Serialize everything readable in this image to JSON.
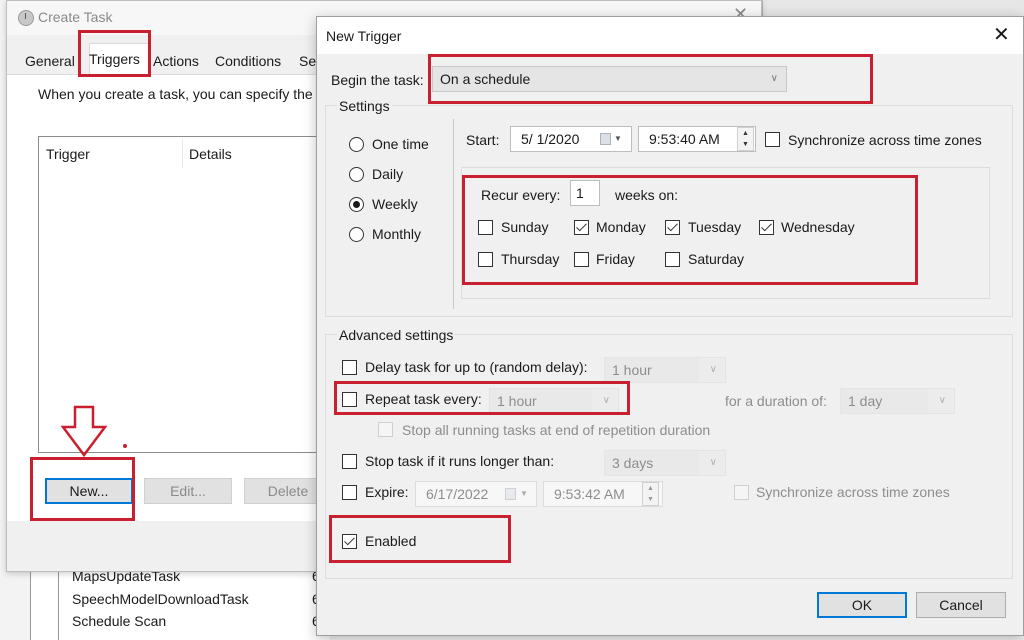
{
  "background": {
    "task_rows": [
      {
        "name": "MapsUpdateTask",
        "extra": "6"
      },
      {
        "name": "SpeechModelDownloadTask",
        "extra": "6"
      },
      {
        "name": "Schedule Scan",
        "extra": "6"
      }
    ]
  },
  "create_task": {
    "title": "Create Task",
    "tabs": [
      "General",
      "Triggers",
      "Actions",
      "Conditions",
      "Set"
    ],
    "active_tab": "Triggers",
    "description": "When you create a task, you can specify the",
    "columns": [
      "Trigger",
      "Details"
    ],
    "buttons": {
      "new": "New...",
      "edit": "Edit...",
      "delete": "Delete"
    }
  },
  "new_trigger": {
    "title": "New Trigger",
    "begin_label": "Begin the task:",
    "begin_value": "On a schedule",
    "settings_label": "Settings",
    "schedule_options": [
      {
        "label": "One time",
        "checked": false
      },
      {
        "label": "Daily",
        "checked": false
      },
      {
        "label": "Weekly",
        "checked": true
      },
      {
        "label": "Monthly",
        "checked": false
      }
    ],
    "start_label": "Start:",
    "start_date": "5/ 1/2020",
    "start_time": "9:53:40 AM",
    "sync_label": "Synchronize across time zones",
    "sync_checked": false,
    "recur_label": "Recur every:",
    "recur_value": "1",
    "recur_unit": "weeks on:",
    "days": [
      {
        "label": "Sunday",
        "checked": false
      },
      {
        "label": "Monday",
        "checked": true
      },
      {
        "label": "Tuesday",
        "checked": true
      },
      {
        "label": "Wednesday",
        "checked": true
      },
      {
        "label": "Thursday",
        "checked": false
      },
      {
        "label": "Friday",
        "checked": false
      },
      {
        "label": "Saturday",
        "checked": false
      }
    ],
    "advanced": {
      "label": "Advanced settings",
      "delay_label": "Delay task for up to (random delay):",
      "delay_value": "1 hour",
      "repeat_label": "Repeat task every:",
      "repeat_value": "1 hour",
      "duration_label": "for a duration of:",
      "duration_value": "1 day",
      "stop_all_label": "Stop all running tasks at end of repetition duration",
      "stop_longer_label": "Stop task if it runs longer than:",
      "stop_longer_value": "3 days",
      "expire_label": "Expire:",
      "expire_date": "6/17/2022",
      "expire_time": "9:53:42 AM",
      "expire_sync_label": "Synchronize across time zones",
      "enabled_label": "Enabled",
      "enabled_checked": true
    },
    "buttons": {
      "ok": "OK",
      "cancel": "Cancel"
    }
  },
  "annotations": {
    "highlight_color": "#c8202f"
  }
}
